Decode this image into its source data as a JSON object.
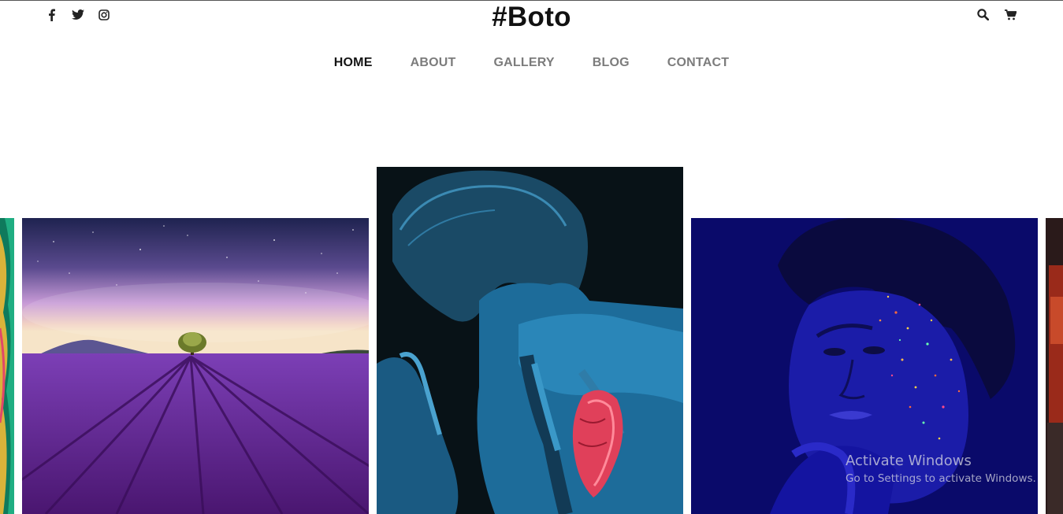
{
  "header": {
    "logo": "#Boto",
    "social_icons": [
      "facebook-icon",
      "twitter-icon",
      "instagram-icon"
    ],
    "tool_icons": [
      "search-icon",
      "cart-icon"
    ]
  },
  "nav": {
    "items": [
      {
        "label": "HOME",
        "active": true
      },
      {
        "label": "ABOUT",
        "active": false
      },
      {
        "label": "GALLERY",
        "active": false
      },
      {
        "label": "BLOG",
        "active": false
      },
      {
        "label": "CONTACT",
        "active": false
      }
    ]
  },
  "gallery": {
    "images": [
      {
        "subject": "tropical-leaves-edge"
      },
      {
        "subject": "lavender-field-tree-night-sky"
      },
      {
        "subject": "man-blue-paint-red-heart"
      },
      {
        "subject": "woman-blue-glitter-face"
      },
      {
        "subject": "red-edge"
      }
    ]
  },
  "watermark": {
    "title": "Activate Windows",
    "subtitle": "Go to Settings to activate Windows."
  },
  "colors": {
    "accent": "#a0c64a",
    "nav_text": "#7c7c7c",
    "nav_active": "#141414"
  }
}
